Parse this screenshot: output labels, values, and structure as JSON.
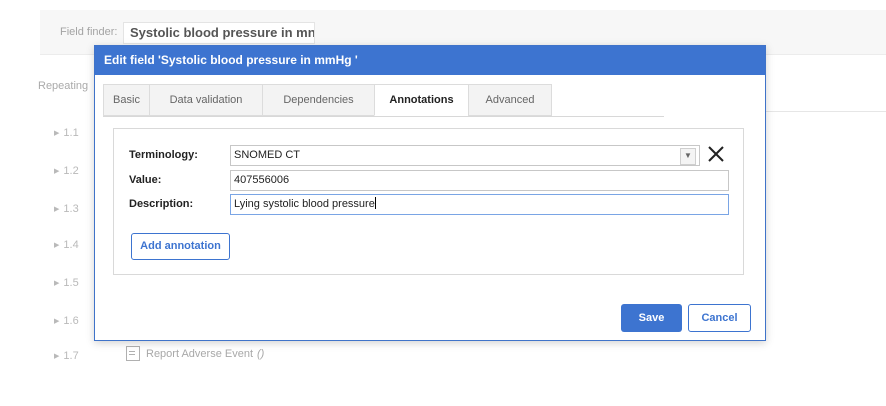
{
  "background": {
    "field_finder_label": "Field finder:",
    "field_finder_value": "Systolic blood pressure in mn",
    "repeating_label": "Repeating",
    "rows": [
      {
        "num": "1.1"
      },
      {
        "num": "1.2"
      },
      {
        "num": "1.3"
      },
      {
        "num": "1.4"
      },
      {
        "num": "1.5"
      },
      {
        "num": "1.6"
      },
      {
        "num": "1.7"
      }
    ],
    "row7_item": "Report Adverse Event",
    "row7_suffix": "()"
  },
  "modal": {
    "title": "Edit field 'Systolic blood pressure in mmHg '",
    "tabs": [
      "Basic",
      "Data validation",
      "Dependencies",
      "Annotations",
      "Advanced"
    ],
    "active_tab": "Annotations",
    "terminology_label": "Terminology:",
    "terminology_value": "SNOMED CT",
    "value_label": "Value:",
    "value_value": "407556006",
    "description_label": "Description:",
    "description_value": "Lying systolic blood pressure",
    "add_annotation_label": "Add annotation",
    "save_label": "Save",
    "cancel_label": "Cancel"
  },
  "colors": {
    "accent": "#3d74d0",
    "header_text": "#ffffff"
  }
}
